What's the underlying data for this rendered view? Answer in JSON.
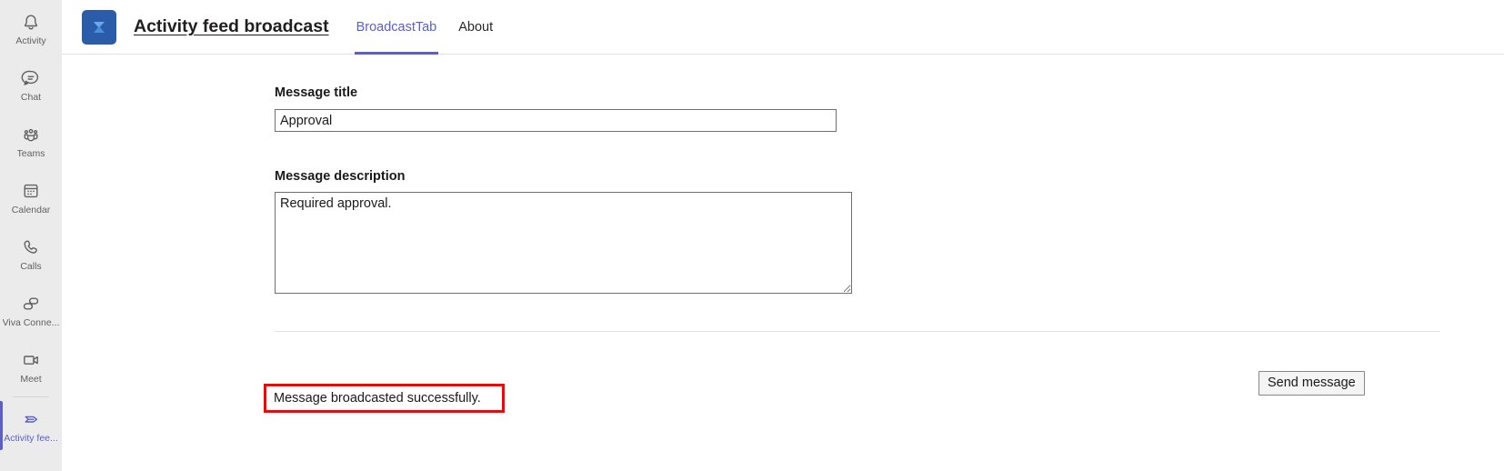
{
  "rail": {
    "items": [
      {
        "label": "Activity",
        "icon": "bell-icon",
        "active": false
      },
      {
        "label": "Chat",
        "icon": "chat-bubble-icon",
        "active": false
      },
      {
        "label": "Teams",
        "icon": "people-icon",
        "active": false
      },
      {
        "label": "Calendar",
        "icon": "calendar-icon",
        "active": false
      },
      {
        "label": "Calls",
        "icon": "phone-icon",
        "active": false
      },
      {
        "label": "Viva Conne...",
        "icon": "viva-connections-icon",
        "active": false
      },
      {
        "label": "Meet",
        "icon": "video-camera-icon",
        "active": false
      },
      {
        "label": "Activity fee...",
        "icon": "broadcast-send-icon",
        "active": true
      }
    ]
  },
  "header": {
    "app_icon_name": "activity-feed-broadcast-app-icon",
    "title": "Activity feed broadcast",
    "tabs": [
      {
        "label": "BroadcastTab",
        "active": true
      },
      {
        "label": "About",
        "active": false
      }
    ]
  },
  "form": {
    "title_label": "Message title",
    "title_value": "Approval",
    "title_placeholder": "",
    "description_label": "Message description",
    "description_value": "Required approval.",
    "description_placeholder": "",
    "send_button_label": "Send message"
  },
  "status": {
    "message": "Message broadcasted successfully.",
    "highlight_color": "#FE0000"
  },
  "colors": {
    "accent": "#5B5FC7",
    "rail_background": "#EBEBEB",
    "app_icon_background": "#2A5CAA"
  }
}
